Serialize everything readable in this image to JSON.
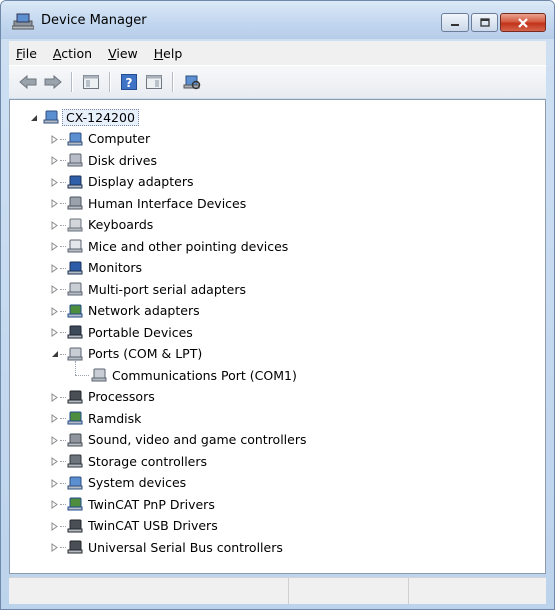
{
  "window": {
    "title": "Device Manager"
  },
  "menu": [
    {
      "label": "File",
      "acc": "F",
      "rest": "ile"
    },
    {
      "label": "Action",
      "acc": "A",
      "rest": "ction"
    },
    {
      "label": "View",
      "acc": "V",
      "rest": "iew"
    },
    {
      "label": "Help",
      "acc": "H",
      "rest": "elp"
    }
  ],
  "toolbar": {
    "icons": [
      "back-arrow-icon",
      "forward-arrow-icon",
      "show-hide-console-tree-icon",
      "help-icon",
      "properties-icon",
      "scan-hardware-icon"
    ]
  },
  "tree": {
    "root": {
      "label": "CX-124200",
      "icon": "computer-icon",
      "expanded": true
    },
    "categories": [
      {
        "label": "Computer",
        "icon": "computer-icon",
        "expanded": false
      },
      {
        "label": "Disk drives",
        "icon": "disk-drive-icon",
        "expanded": false
      },
      {
        "label": "Display adapters",
        "icon": "display-adapter-icon",
        "expanded": false
      },
      {
        "label": "Human Interface Devices",
        "icon": "hid-icon",
        "expanded": false
      },
      {
        "label": "Keyboards",
        "icon": "keyboard-icon",
        "expanded": false
      },
      {
        "label": "Mice and other pointing devices",
        "icon": "mouse-icon",
        "expanded": false
      },
      {
        "label": "Monitors",
        "icon": "monitor-icon",
        "expanded": false
      },
      {
        "label": "Multi-port serial adapters",
        "icon": "serial-port-icon",
        "expanded": false
      },
      {
        "label": "Network adapters",
        "icon": "network-adapter-icon",
        "expanded": false
      },
      {
        "label": "Portable Devices",
        "icon": "portable-device-icon",
        "expanded": false
      },
      {
        "label": "Ports (COM & LPT)",
        "icon": "port-icon",
        "expanded": true,
        "children": [
          {
            "label": "Communications Port (COM1)",
            "icon": "port-icon"
          }
        ]
      },
      {
        "label": "Processors",
        "icon": "processor-icon",
        "expanded": false
      },
      {
        "label": "Ramdisk",
        "icon": "ramdisk-icon",
        "expanded": false
      },
      {
        "label": "Sound, video and game controllers",
        "icon": "speaker-icon",
        "expanded": false
      },
      {
        "label": "Storage controllers",
        "icon": "storage-controller-icon",
        "expanded": false
      },
      {
        "label": "System devices",
        "icon": "system-device-icon",
        "expanded": false
      },
      {
        "label": "TwinCAT PnP Drivers",
        "icon": "network-adapter-icon",
        "expanded": false
      },
      {
        "label": "TwinCAT USB Drivers",
        "icon": "usb-icon",
        "expanded": false
      },
      {
        "label": "Universal Serial Bus controllers",
        "icon": "usb-icon",
        "expanded": false
      }
    ]
  },
  "statusbar": {
    "panes": [
      "",
      "",
      ""
    ]
  }
}
